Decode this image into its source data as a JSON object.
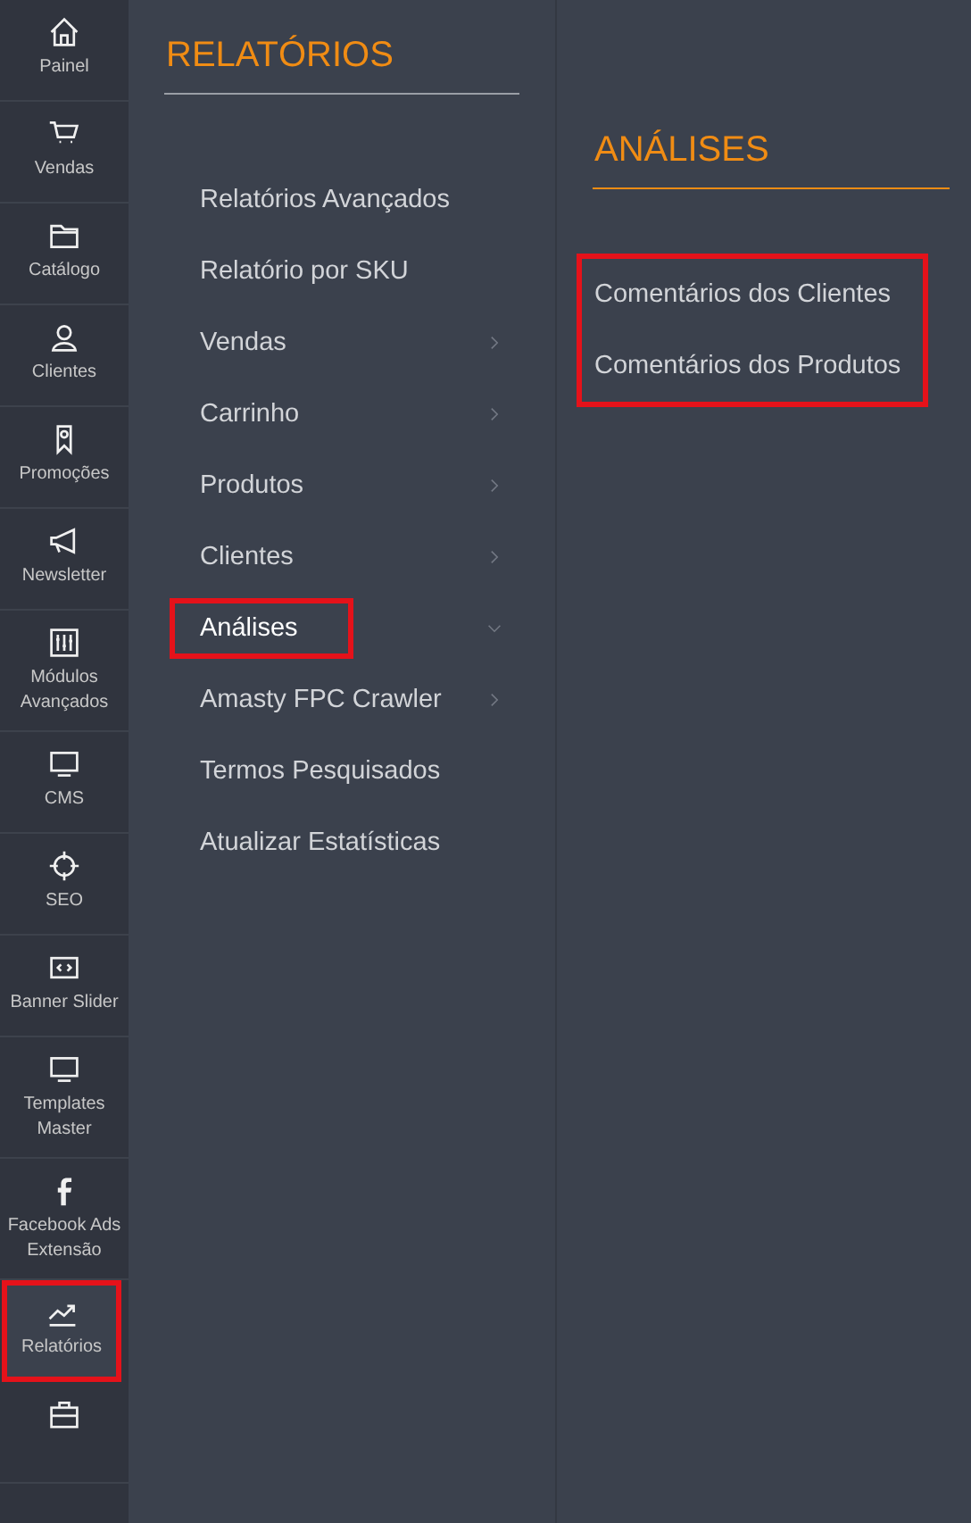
{
  "sidebar": {
    "items": [
      {
        "label": "Painel",
        "selected": false,
        "highlighted": false
      },
      {
        "label": "Vendas",
        "selected": false,
        "highlighted": false
      },
      {
        "label": "Catálogo",
        "selected": false,
        "highlighted": false
      },
      {
        "label": "Clientes",
        "selected": false,
        "highlighted": false
      },
      {
        "label": "Promoções",
        "selected": false,
        "highlighted": false
      },
      {
        "label": "Newsletter",
        "selected": false,
        "highlighted": false
      },
      {
        "label": "Módulos Avançados",
        "selected": false,
        "highlighted": false
      },
      {
        "label": "CMS",
        "selected": false,
        "highlighted": false
      },
      {
        "label": "SEO",
        "selected": false,
        "highlighted": false
      },
      {
        "label": "Banner Slider",
        "selected": false,
        "highlighted": false
      },
      {
        "label": "Templates Master",
        "selected": false,
        "highlighted": false
      },
      {
        "label": "Facebook Ads Extensão",
        "selected": false,
        "highlighted": false
      },
      {
        "label": "Relatórios",
        "selected": true,
        "highlighted": true
      },
      {
        "selected": false,
        "highlighted": false
      }
    ]
  },
  "menu": {
    "title": "RELATÓRIOS",
    "items": [
      {
        "label": "Relatórios Avançados",
        "has_children": false,
        "expanded": false,
        "highlighted": false
      },
      {
        "label": "Relatório por SKU",
        "has_children": false,
        "expanded": false,
        "highlighted": false
      },
      {
        "label": "Vendas",
        "has_children": true,
        "expanded": false,
        "highlighted": false
      },
      {
        "label": "Carrinho",
        "has_children": true,
        "expanded": false,
        "highlighted": false
      },
      {
        "label": "Produtos",
        "has_children": true,
        "expanded": false,
        "highlighted": false
      },
      {
        "label": "Clientes",
        "has_children": true,
        "expanded": false,
        "highlighted": false
      },
      {
        "label": "Análises",
        "has_children": true,
        "expanded": true,
        "highlighted": true
      },
      {
        "label": "Amasty FPC Crawler",
        "has_children": true,
        "expanded": false,
        "highlighted": false
      },
      {
        "label": "Termos Pesquisados",
        "has_children": false,
        "expanded": false,
        "highlighted": false
      },
      {
        "label": "Atualizar Estatísticas",
        "has_children": false,
        "expanded": false,
        "highlighted": false
      }
    ]
  },
  "submenu": {
    "title": "ANÁLISES",
    "highlighted": true,
    "items": [
      {
        "label": "Comentários dos Clientes"
      },
      {
        "label": "Comentários dos Produtos"
      }
    ]
  }
}
